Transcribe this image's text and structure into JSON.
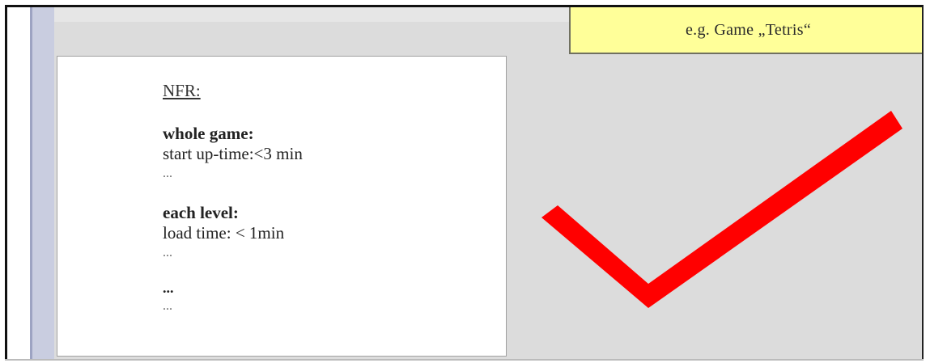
{
  "slide": {
    "title": "e.g. Game „Tetris“",
    "card": {
      "heading": "NFR:",
      "section1": {
        "title": "whole game:",
        "line": "start up-time:<3 min",
        "dots": "..."
      },
      "section2": {
        "title": "each level:",
        "line": "load time: < 1min",
        "dots": "..."
      },
      "section3": {
        "title": "...",
        "dots": "..."
      }
    },
    "checkmark": {
      "icon": "checkmark-icon",
      "color": "#ff0000"
    }
  },
  "colors": {
    "title_box_bg": "#ffff99",
    "slide_bg": "#dcdcdc",
    "left_strip": "#c9cde0"
  }
}
